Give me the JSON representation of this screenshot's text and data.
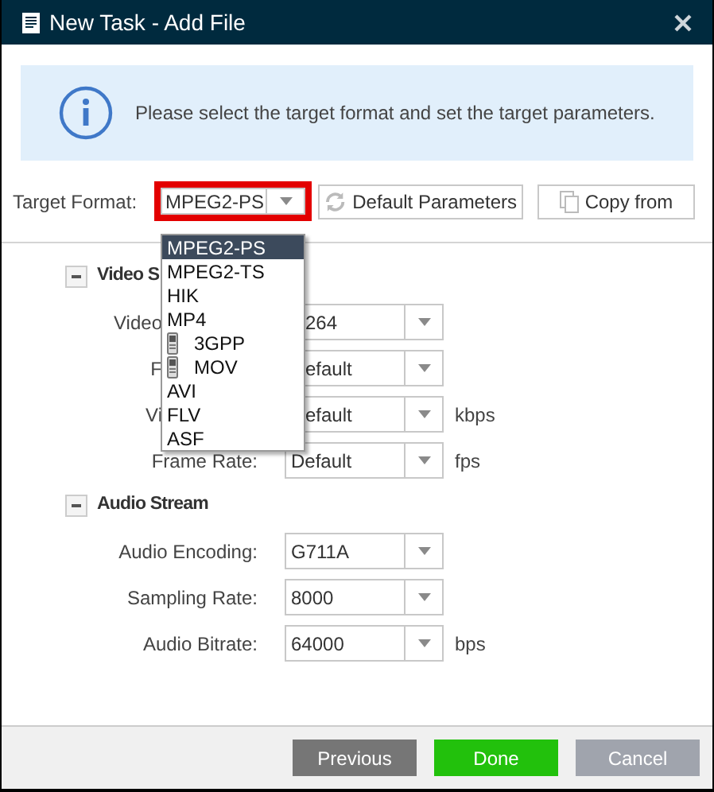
{
  "window": {
    "title": "New Task - Add File"
  },
  "info": {
    "message": "Please select the target format and set the target parameters."
  },
  "target_format": {
    "label": "Target Format:",
    "value": "MPEG2-PS",
    "highlighted": true
  },
  "toolbar_buttons": [
    {
      "kind": "refresh",
      "label": "Default Parameters"
    },
    {
      "kind": "copy",
      "label": "Copy from"
    }
  ],
  "format_menu": [
    {
      "label": "MPEG2-PS",
      "selected": true,
      "kind": "plain"
    },
    {
      "label": "MPEG2-TS",
      "selected": false,
      "kind": "plain"
    },
    {
      "label": "HIK",
      "selected": false,
      "kind": "plain"
    },
    {
      "label": "MP4",
      "selected": false,
      "kind": "plain"
    },
    {
      "label": "3GPP",
      "selected": false,
      "kind": "mobile"
    },
    {
      "label": "MOV",
      "selected": false,
      "kind": "mobile"
    },
    {
      "label": "AVI",
      "selected": false,
      "kind": "plain"
    },
    {
      "label": "FLV",
      "selected": false,
      "kind": "plain"
    },
    {
      "label": "ASF",
      "selected": false,
      "kind": "plain"
    }
  ],
  "sections": [
    {
      "title": "Video S",
      "expanded": true,
      "rows": [
        {
          "label": "Video",
          "value": "264",
          "covered": true
        },
        {
          "label": "F",
          "value": "efault",
          "covered": true
        },
        {
          "label": "Vi",
          "value": "efault",
          "unit": "kbps",
          "covered": true
        },
        {
          "label": "Frame Rate:",
          "value": "Default",
          "unit": "fps",
          "covered": false
        }
      ]
    },
    {
      "title": "Audio Stream",
      "expanded": true,
      "rows": [
        {
          "label": "Audio Encoding:",
          "value": "G711A",
          "covered": false
        },
        {
          "label": "Sampling Rate:",
          "value": "8000",
          "covered": false
        },
        {
          "label": "Audio Bitrate:",
          "value": "64000",
          "unit": "bps",
          "covered": false
        }
      ]
    }
  ],
  "footer_buttons": [
    {
      "kind": "secondary",
      "label": "Previous"
    },
    {
      "kind": "primary",
      "label": "Done"
    },
    {
      "kind": "cancel",
      "label": "Cancel"
    }
  ]
}
